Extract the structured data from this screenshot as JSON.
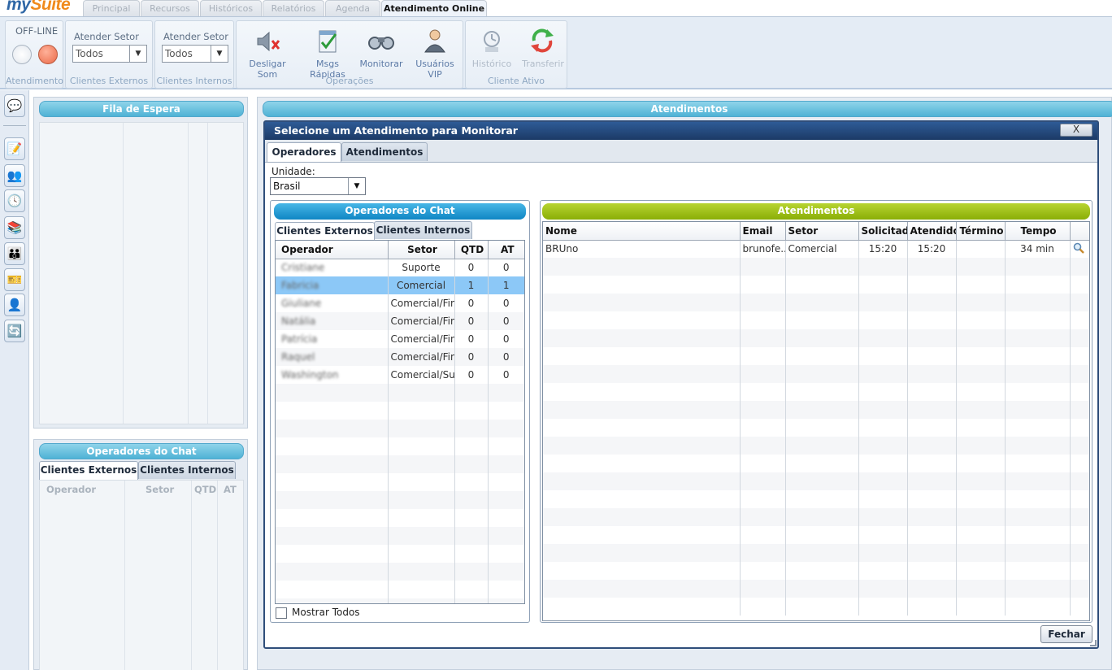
{
  "logo": {
    "prefix": "my",
    "suffix": "Suite"
  },
  "nav_tabs": [
    "Principal",
    "Recursos",
    "Históricos",
    "Relatórios",
    "Agenda",
    "Atendimento Online"
  ],
  "ribbon": {
    "atendimento": {
      "status": "OFF-LINE",
      "group_label": "Atendimento"
    },
    "clientes_externos": {
      "label": "Atender Setor",
      "value": "Todos",
      "group_label": "Clientes Externos"
    },
    "clientes_internos": {
      "label": "Atender Setor",
      "value": "Todos",
      "group_label": "Clientes Internos"
    },
    "operacoes": {
      "group_label": "Operações",
      "buttons": [
        "Desligar Som",
        "Msgs Rápidas",
        "Monitorar",
        "Usuários VIP"
      ]
    },
    "cliente_ativo": {
      "group_label": "Cliente Ativo",
      "buttons": [
        "Histórico",
        "Transferir"
      ]
    }
  },
  "background": {
    "fila_title": "Fila de Espera",
    "atendimentos_title": "Atendimentos",
    "operadores_title": "Operadores do Chat",
    "tabs": [
      "Clientes Externos",
      "Clientes Internos"
    ],
    "columns": [
      "Operador",
      "Setor",
      "QTD",
      "AT"
    ]
  },
  "modal": {
    "title": "Selecione um Atendimento para Monitorar",
    "close_label": "X",
    "tabs": [
      "Operadores",
      "Atendimentos"
    ],
    "unidade_label": "Unidade:",
    "unidade_value": "Brasil",
    "operadores": {
      "title": "Operadores do Chat",
      "tabs": [
        "Clientes Externos",
        "Clientes Internos"
      ],
      "columns": [
        "Operador",
        "Setor",
        "QTD",
        "AT"
      ],
      "rows": [
        {
          "operador": "Cristiane",
          "setor": "Suporte",
          "qtd": "0",
          "at": "0"
        },
        {
          "operador": "Fabricia",
          "setor": "Comercial",
          "qtd": "1",
          "at": "1"
        },
        {
          "operador": "Giuliane",
          "setor": "Comercial/Fina",
          "qtd": "0",
          "at": "0"
        },
        {
          "operador": "Natália",
          "setor": "Comercial/Fina",
          "qtd": "0",
          "at": "0"
        },
        {
          "operador": "Patrícia",
          "setor": "Comercial/Fina",
          "qtd": "0",
          "at": "0"
        },
        {
          "operador": "Raquel",
          "setor": "Comercial/Fina",
          "qtd": "0",
          "at": "0"
        },
        {
          "operador": "Washington",
          "setor": "Comercial/Sup",
          "qtd": "0",
          "at": "0"
        }
      ],
      "selected_index": 1,
      "mostrar_todos": "Mostrar Todos"
    },
    "atendimentos": {
      "title": "Atendimentos",
      "columns": [
        "Nome",
        "Email",
        "Setor",
        "Solicitado",
        "Atendido",
        "Término",
        "Tempo"
      ],
      "rows": [
        {
          "nome": "BRUno",
          "email": "brunofe...",
          "setor": "Comercial",
          "solicitado": "15:20",
          "atendido": "15:20",
          "termino": "",
          "tempo": "34 min"
        }
      ]
    },
    "fechar_label": "Fechar"
  }
}
